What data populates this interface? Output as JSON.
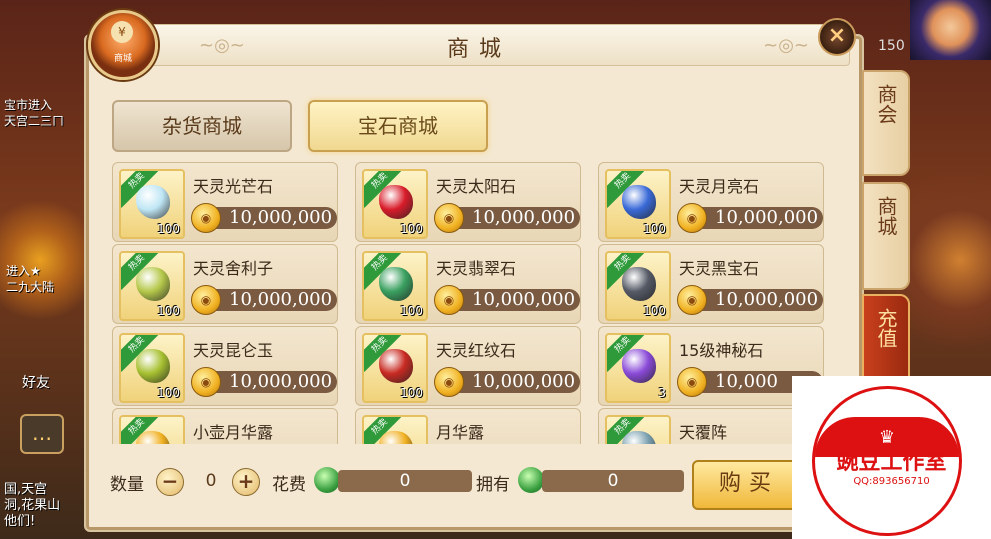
{
  "window": {
    "title": "商城"
  },
  "badge": {
    "label": "商城",
    "symbol": "¥"
  },
  "close_symbol": "×",
  "tabs": [
    {
      "label": "杂货商城",
      "selected": false
    },
    {
      "label": "宝石商城",
      "selected": true
    }
  ],
  "side_tabs": [
    {
      "label": "商会"
    },
    {
      "label": "商城"
    },
    {
      "label": "充值"
    }
  ],
  "hot_label": "热卖",
  "items": [
    {
      "name": "天灵光芒石",
      "price": "10,000,000",
      "qty": "100",
      "color": "#bfe6f5"
    },
    {
      "name": "天灵太阳石",
      "price": "10,000,000",
      "qty": "100",
      "color": "#d81c2a"
    },
    {
      "name": "天灵月亮石",
      "price": "10,000,000",
      "qty": "100",
      "color": "#3a6ad8"
    },
    {
      "name": "天灵舍利子",
      "price": "10,000,000",
      "qty": "100",
      "color": "#b5c84a"
    },
    {
      "name": "天灵翡翠石",
      "price": "10,000,000",
      "qty": "100",
      "color": "#3aa060"
    },
    {
      "name": "天灵黑宝石",
      "price": "10,000,000",
      "qty": "100",
      "color": "#555a66"
    },
    {
      "name": "天灵昆仑玉",
      "price": "10,000,000",
      "qty": "100",
      "color": "#a6c030"
    },
    {
      "name": "天灵红纹石",
      "price": "10,000,000",
      "qty": "100",
      "color": "#c82a22"
    },
    {
      "name": "15级神秘石",
      "price": "10,000",
      "qty": "3",
      "color": "#8a4ad8"
    },
    {
      "name": "小壶月华露",
      "price": "",
      "qty": "",
      "color": "#f0b020"
    },
    {
      "name": "月华露",
      "price": "",
      "qty": "",
      "color": "#f0b020"
    },
    {
      "name": "天覆阵",
      "price": "",
      "qty": "",
      "color": "#7aa0b0"
    }
  ],
  "bottom": {
    "quantity_label": "数量",
    "quantity_value": "0",
    "cost_label": "花费",
    "cost_value": "0",
    "owned_label": "拥有",
    "owned_value": "0",
    "buy_label": "购买",
    "minus": "−",
    "plus": "+"
  },
  "background": {
    "top_right_count": "150",
    "left_texts": [
      "宝市进入",
      "天宫二三ㄇ",
      "进入★",
      "二九大陆",
      "好友",
      "国,天宫",
      "洞,花果山",
      "他们!"
    ]
  },
  "watermark": {
    "text": "豌豆工作室",
    "sub": "QQ:893656710"
  }
}
